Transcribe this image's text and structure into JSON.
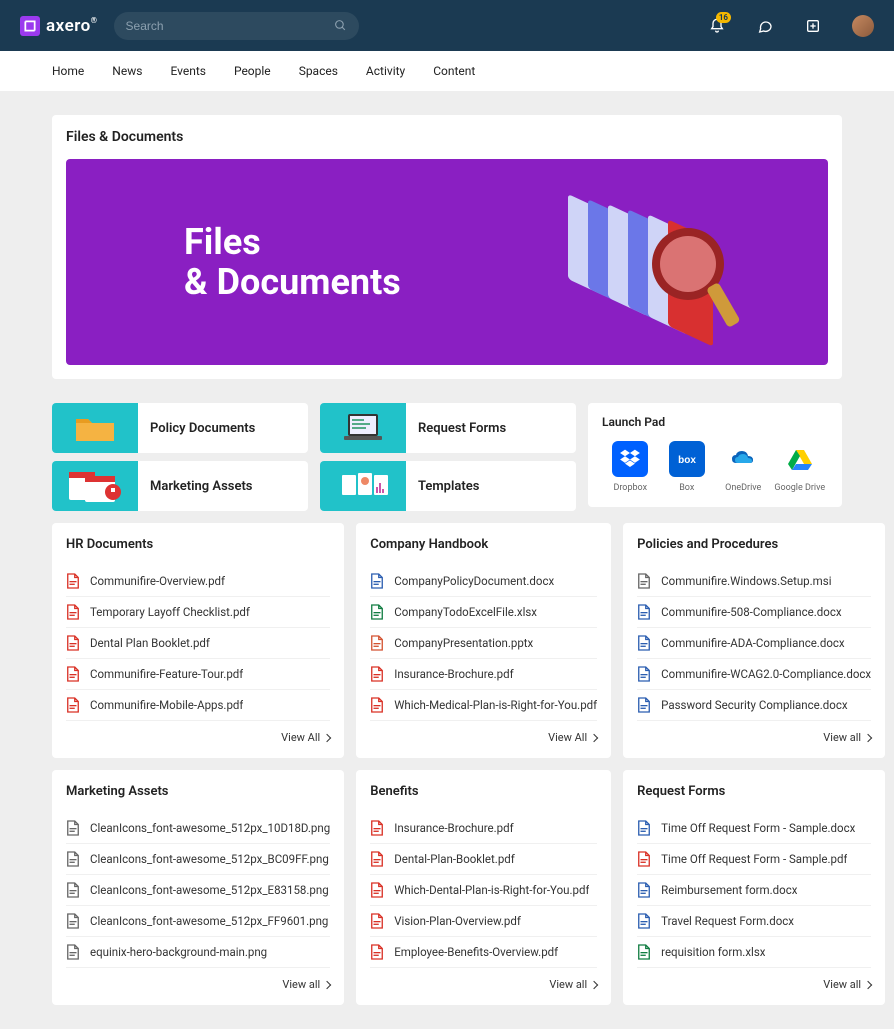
{
  "brand": {
    "name": "axero"
  },
  "search": {
    "placeholder": "Search"
  },
  "notifications": {
    "count": "16"
  },
  "nav": [
    {
      "label": "Home"
    },
    {
      "label": "News"
    },
    {
      "label": "Events"
    },
    {
      "label": "People"
    },
    {
      "label": "Spaces"
    },
    {
      "label": "Activity"
    },
    {
      "label": "Content"
    }
  ],
  "page": {
    "title": "Files & Documents",
    "hero_line1": "Files",
    "hero_line2": "& Documents"
  },
  "categories": [
    {
      "label": "Policy Documents"
    },
    {
      "label": "Request Forms"
    },
    {
      "label": "Marketing Assets"
    },
    {
      "label": "Templates"
    }
  ],
  "launchpad": {
    "title": "Launch Pad",
    "apps": [
      {
        "label": "Dropbox",
        "icon": "dropbox"
      },
      {
        "label": "Box",
        "icon": "box"
      },
      {
        "label": "OneDrive",
        "icon": "onedrive"
      },
      {
        "label": "Google Drive",
        "icon": "gdrive"
      }
    ]
  },
  "sections": [
    {
      "title": "HR Documents",
      "view_all": "View All",
      "items": [
        {
          "name": "Communifire-Overview.pdf",
          "type": "pdf"
        },
        {
          "name": "Temporary Layoff Checklist.pdf",
          "type": "pdf"
        },
        {
          "name": "Dental Plan Booklet.pdf",
          "type": "pdf"
        },
        {
          "name": "Communifire-Feature-Tour.pdf",
          "type": "pdf"
        },
        {
          "name": "Communifire-Mobile-Apps.pdf",
          "type": "pdf"
        }
      ]
    },
    {
      "title": "Company Handbook",
      "view_all": "View All",
      "items": [
        {
          "name": "CompanyPolicyDocument.docx",
          "type": "docx"
        },
        {
          "name": "CompanyTodoExcelFile.xlsx",
          "type": "xlsx"
        },
        {
          "name": "CompanyPresentation.pptx",
          "type": "pptx"
        },
        {
          "name": "Insurance-Brochure.pdf",
          "type": "pdf"
        },
        {
          "name": "Which-Medical-Plan-is-Right-for-You.pdf",
          "type": "pdf"
        }
      ]
    },
    {
      "title": "Policies and Procedures",
      "view_all": "View all",
      "items": [
        {
          "name": "Communifire.Windows.Setup.msi",
          "type": "file"
        },
        {
          "name": "Communifire-508-Compliance.docx",
          "type": "docx"
        },
        {
          "name": "Communifire-ADA-Compliance.docx",
          "type": "docx"
        },
        {
          "name": "Communifire-WCAG2.0-Compliance.docx",
          "type": "docx"
        },
        {
          "name": "Password Security Compliance.docx",
          "type": "docx"
        }
      ]
    },
    {
      "title": "Marketing Assets",
      "view_all": "View all",
      "items": [
        {
          "name": "CleanIcons_font-awesome_512px_10D18D.png",
          "type": "png"
        },
        {
          "name": "CleanIcons_font-awesome_512px_BC09FF.png",
          "type": "png"
        },
        {
          "name": "CleanIcons_font-awesome_512px_E83158.png",
          "type": "png"
        },
        {
          "name": "CleanIcons_font-awesome_512px_FF9601.png",
          "type": "png"
        },
        {
          "name": "equinix-hero-background-main.png",
          "type": "png"
        }
      ]
    },
    {
      "title": "Benefits",
      "view_all": "View all",
      "items": [
        {
          "name": "Insurance-Brochure.pdf",
          "type": "pdf"
        },
        {
          "name": "Dental-Plan-Booklet.pdf",
          "type": "pdf"
        },
        {
          "name": "Which-Dental-Plan-is-Right-for-You.pdf",
          "type": "pdf"
        },
        {
          "name": "Vision-Plan-Overview.pdf",
          "type": "pdf"
        },
        {
          "name": "Employee-Benefits-Overview.pdf",
          "type": "pdf"
        }
      ]
    },
    {
      "title": "Request Forms",
      "view_all": "View all",
      "items": [
        {
          "name": "Time Off Request Form - Sample.docx",
          "type": "docx"
        },
        {
          "name": "Time Off Request Form - Sample.pdf",
          "type": "pdf"
        },
        {
          "name": "Reimbursement form.docx",
          "type": "docx"
        },
        {
          "name": "Travel Request Form.docx",
          "type": "docx"
        },
        {
          "name": "requisition form.xlsx",
          "type": "xlsx"
        }
      ]
    }
  ]
}
